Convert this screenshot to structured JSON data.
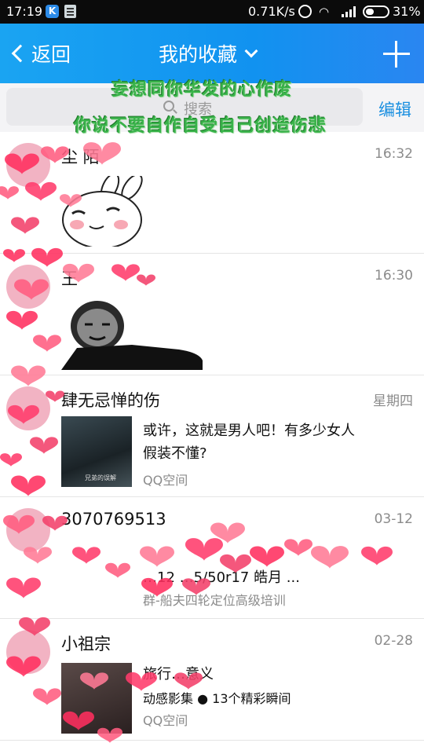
{
  "status_bar": {
    "time": "17:19",
    "speed": "0.71K/s",
    "battery": "31%",
    "icons": [
      "k-app-icon",
      "doc-icon",
      "alarm-icon",
      "wifi-icon",
      "signal-icon",
      "battery-icon"
    ]
  },
  "header": {
    "back_label": "返回",
    "title": "我的收藏",
    "add_icon": "plus-icon"
  },
  "search": {
    "placeholder": "搜索",
    "edit_label": "编辑"
  },
  "lyrics": {
    "line1": "妄想同你华发的心作废",
    "line2": "你说不要自作自受自己创造伤悲"
  },
  "items": [
    {
      "name": "尘 陌",
      "time": "16:32"
    },
    {
      "name": "王",
      "time": "16:30"
    },
    {
      "name": "肆无忌惮的伤",
      "time": "星期四",
      "text": "或许，这就是男人吧！有多少女人假装不懂?",
      "text_line1": "或许，这就是男人吧！有多少女人",
      "text_line2": "假装不懂?",
      "thumb_caption": "兄弟的误解",
      "source": "QQ空间"
    },
    {
      "name": "3070769513",
      "time": "03-12",
      "text": "…12 …5/50r17 皓月 ...",
      "source": "群-船夫四轮定位高级培训"
    },
    {
      "name": "小祖宗",
      "time": "02-28",
      "title_line": "旅行…意义",
      "meta": "动感影集 ● 13个精彩瞬间",
      "source": "QQ空间"
    }
  ],
  "colors": {
    "header": "#1597f0",
    "accent": "#1a8fe0",
    "lyric": "#39b34a",
    "heart": "#ff3b6b"
  }
}
